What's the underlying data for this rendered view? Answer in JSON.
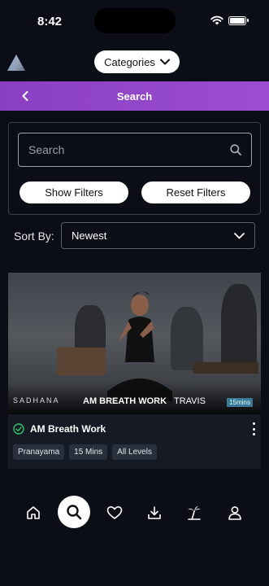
{
  "status_bar": {
    "time": "8:42"
  },
  "header": {
    "categories_label": "Categories",
    "title": "Search"
  },
  "search": {
    "placeholder": "Search",
    "value": "",
    "show_filters_label": "Show Filters",
    "reset_filters_label": "Reset Filters"
  },
  "sort": {
    "label": "Sort By:",
    "selected": "Newest"
  },
  "results": [
    {
      "brand": "SADHANA",
      "overlay_title": "AM BREATH WORK",
      "instructor": "TRAVIS",
      "duration_badge": "15mins",
      "title": "AM Breath Work",
      "tags": [
        "Pranayama",
        "15 Mins",
        "All Levels"
      ]
    }
  ],
  "bottom_nav": [
    "home-icon",
    "search-icon",
    "heart-icon",
    "download-icon",
    "palm-tree-icon",
    "profile-icon"
  ],
  "colors": {
    "background": "#0b0e16",
    "header_gradient_start": "#8a3fc0",
    "header_gradient_end": "#9b4fd0",
    "check": "#35c56b",
    "badge": "#3a7a96"
  }
}
